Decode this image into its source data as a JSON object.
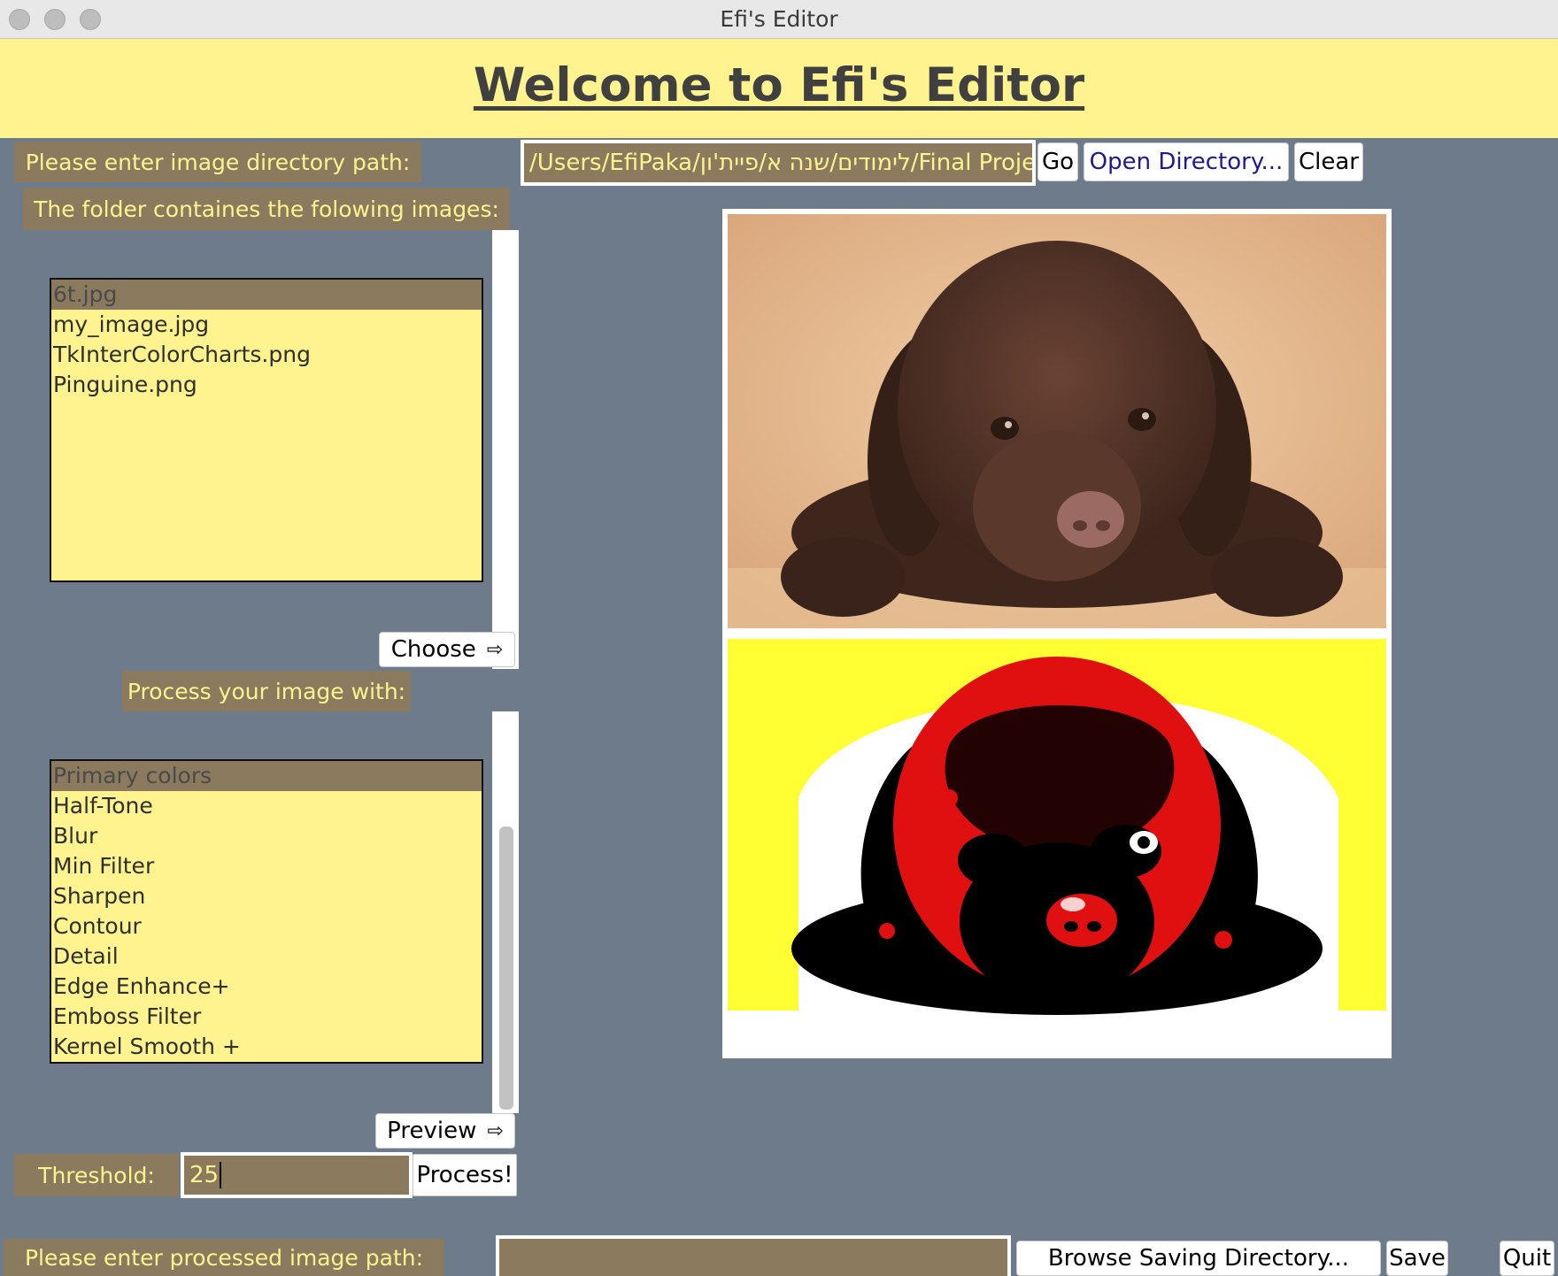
{
  "window": {
    "title": "Efi's Editor"
  },
  "banner": {
    "title": "Welcome to Efi's Editor"
  },
  "directory": {
    "label": "Please enter image directory path:",
    "path_value": "/Users/EfiPaka/לימודים/שנה א/פיית'ון/Final Proje",
    "go_label": "Go",
    "open_label": "Open Directory...",
    "clear_label": "Clear"
  },
  "images_list": {
    "header": "The folder containes the folowing images:",
    "items": [
      "6t.jpg",
      "my_image.jpg",
      "TkInterColorCharts.png",
      "Pinguine.png"
    ],
    "selected": "6t.jpg",
    "choose_label": "Choose"
  },
  "process": {
    "header": "Process your image with:",
    "filters": [
      "Primary colors",
      "Half-Tone",
      "Blur",
      "Min Filter",
      "Sharpen",
      "Contour",
      "Detail",
      "Edge Enhance+",
      "Emboss Filter",
      "Kernel Smooth +"
    ],
    "selected": "Primary colors",
    "preview_label": "Preview"
  },
  "threshold": {
    "label": "Threshold:",
    "value": "25",
    "process_label": "Process!"
  },
  "save": {
    "label": "Please enter processed image path:",
    "path_value": "",
    "browse_label": "Browse Saving Directory...",
    "save_label": "Save",
    "quit_label": "Quit"
  },
  "colors": {
    "background": "#6e7b8b",
    "banner": "#fff38f",
    "label_bg": "#8b7a5e",
    "label_text": "#fff38f"
  },
  "icons": {
    "arrow": "right-arrow-icon",
    "original_image": "chocolate-labrador-puppy-photo",
    "processed_image": "primary-colors-filtered-puppy-photo"
  }
}
